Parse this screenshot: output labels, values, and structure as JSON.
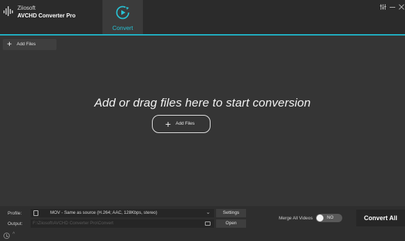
{
  "app": {
    "company": "Ziiosoft",
    "product": "AVCHD Converter Pro"
  },
  "tabs": [
    {
      "label": "Convert",
      "icon": "convert-icon",
      "active": true
    }
  ],
  "window_controls": {
    "menu_icon": "menu-icon",
    "minimize_icon": "minimize-icon",
    "close_icon": "close-icon"
  },
  "toolbar": {
    "add_files_label": "Add Files",
    "add_icon": "plus-icon"
  },
  "drop_area": {
    "hint": "Add or drag files here to start conversion",
    "add_files_label": "Add Files"
  },
  "bottom": {
    "profile_label": "Profile:",
    "profile_value": "MOV - Same as source (H.264; AAC, 128Kbps, stereo)",
    "output_label": "Output:",
    "output_path": "F:\\Ziiosoft\\AVCHD Converter Pro\\Convert",
    "settings_label": "Settings",
    "open_label": "Open",
    "merge_label": "Merge All Videos",
    "merge_state": "NO",
    "convert_all_label": "Convert All"
  },
  "colors": {
    "accent": "#1fb3c6",
    "background": "#353535",
    "titlebar": "#2b2b2b"
  }
}
